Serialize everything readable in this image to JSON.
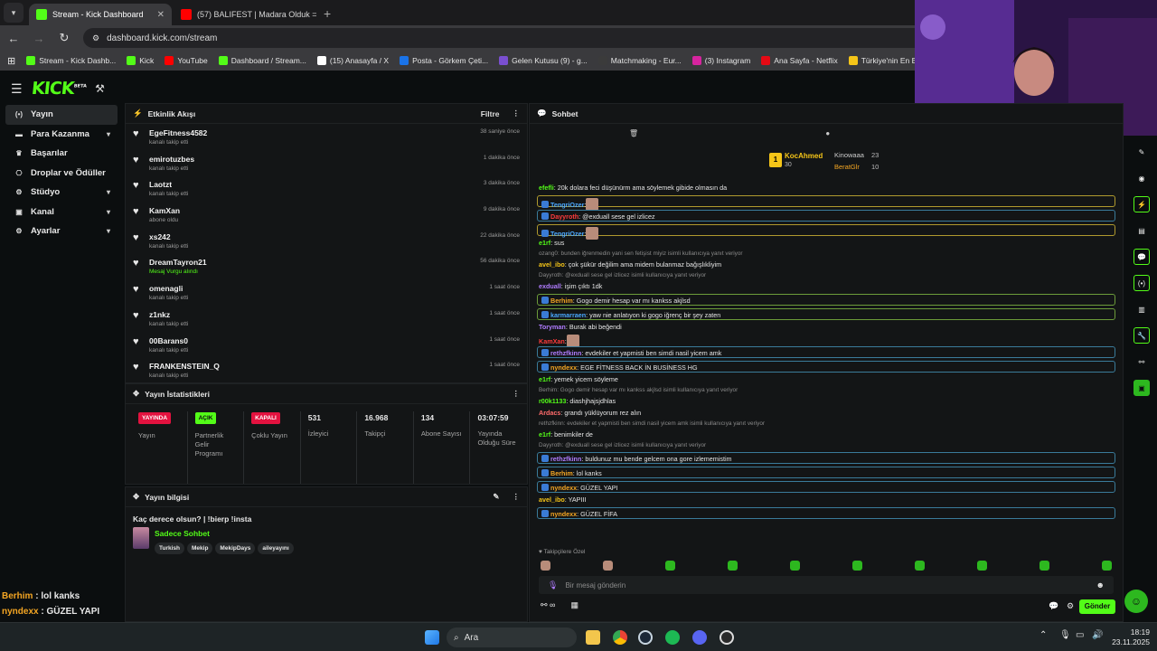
{
  "browser": {
    "tabs": [
      {
        "title": "Stream - Kick Dashboard",
        "color": "#53fc18"
      },
      {
        "title": "(57) BALIFEST | Madara Olduk =",
        "color": "#ff0000"
      }
    ],
    "url": "dashboard.kick.com/stream",
    "bookmarks": [
      {
        "label": "Stream - Kick Dashb...",
        "color": "#53fc18"
      },
      {
        "label": "Kick",
        "color": "#53fc18"
      },
      {
        "label": "YouTube",
        "color": "#ff0000"
      },
      {
        "label": "Dashboard / Stream...",
        "color": "#53fc18"
      },
      {
        "label": "(15) Anasayfa / X",
        "color": "#ffffff"
      },
      {
        "label": "Posta - Görkem Çeti...",
        "color": "#1a73e8"
      },
      {
        "label": "Gelen Kutusu (9) - g...",
        "color": "#7a4fd0"
      },
      {
        "label": "Matchmaking - Eur...",
        "color": "#3b3b3b"
      },
      {
        "label": "(3) Instagram",
        "color": "#d6249f"
      },
      {
        "label": "Ana Sayfa - Netflix",
        "color": "#e50914"
      },
      {
        "label": "Türkiye'nin En Büyü...",
        "color": "#f5c518"
      }
    ]
  },
  "kick": {
    "logo": "KICK",
    "logo_sup": "BETA"
  },
  "sidebar": {
    "items": [
      {
        "label": "Yayın",
        "icon": "broadcast-icon",
        "glyph": "(•)",
        "chev": ""
      },
      {
        "label": "Para Kazanma",
        "icon": "money-icon",
        "glyph": "▬",
        "chev": "▾"
      },
      {
        "label": "Başarılar",
        "icon": "trophy-icon",
        "glyph": "♛",
        "chev": ""
      },
      {
        "label": "Droplar ve Ödüller",
        "icon": "gift-icon",
        "glyph": "⎔",
        "chev": ""
      },
      {
        "label": "Stüdyo",
        "icon": "studio-icon",
        "glyph": "⚙",
        "chev": "▾"
      },
      {
        "label": "Kanal",
        "icon": "channel-icon",
        "glyph": "▣",
        "chev": "▾"
      },
      {
        "label": "Ayarlar",
        "icon": "settings-icon",
        "glyph": "⚙",
        "chev": "▾"
      }
    ]
  },
  "activity": {
    "title": "Etkinlik Akışı",
    "filter": "Filtre",
    "items": [
      {
        "name": "EgeFitness4582",
        "desc": "kanalı takip etti",
        "time": "38 saniye önce"
      },
      {
        "name": "emirotuzbes",
        "desc": "kanalı takip etti",
        "time": "1 dakika önce"
      },
      {
        "name": "Laotzt",
        "desc": "kanalı takip etti",
        "time": "3 dakika önce"
      },
      {
        "name": "KamXan",
        "desc": "abone oldu",
        "time": "9 dakika önce"
      },
      {
        "name": "xs242",
        "desc": "kanalı takip etti",
        "time": "22 dakika önce"
      },
      {
        "name": "DreamTayron21",
        "desc": "Mesaj Vurgu alındı",
        "time": "56 dakika önce"
      },
      {
        "name": "omenagli",
        "desc": "kanalı takip etti",
        "time": "1 saat önce"
      },
      {
        "name": "z1nkz",
        "desc": "kanalı takip etti",
        "time": "1 saat önce"
      },
      {
        "name": "00Barans0",
        "desc": "kanalı takip etti",
        "time": "1 saat önce"
      },
      {
        "name": "FRANKENSTEIN_Q",
        "desc": "kanalı takip etti",
        "time": "1 saat önce"
      }
    ]
  },
  "stats": {
    "title": "Yayın İstatistikleri",
    "items": [
      {
        "badge": "YAYINDA",
        "badge_bg": "#e3123f",
        "badge_fg": "#ffffff",
        "label": "Yayın"
      },
      {
        "badge": "AÇIK",
        "badge_bg": "#53fc18",
        "badge_fg": "#0b0e0f",
        "label": "Partnerlik Gelir Programı"
      },
      {
        "badge": "KAPALI",
        "badge_bg": "#e3123f",
        "badge_fg": "#ffffff",
        "label": "Çoklu Yayın"
      },
      {
        "value": "531",
        "label": "İzleyici"
      },
      {
        "value": "16.968",
        "label": "Takipçi"
      },
      {
        "value": "134",
        "label": "Abone Sayısı"
      },
      {
        "value": "03:07:59",
        "label": "Yayında Olduğu Süre"
      }
    ]
  },
  "info": {
    "title": "Yayın bilgisi",
    "stream_title": "Kaç derece olsun? | !bierp !insta",
    "category": "Sadece Sohbet",
    "tags": [
      "Turkish",
      "Mekip",
      "MekipDays",
      "aileyayını"
    ]
  },
  "chat": {
    "title": "Sohbet",
    "top": [
      {
        "name": "KocAhmed",
        "value": "30"
      },
      {
        "name": "Kinowaaa",
        "value": "23"
      },
      {
        "name": "BeratGlr",
        "value": "10"
      }
    ],
    "messages": [
      {
        "user": "efefli",
        "color": "#53fc18",
        "text": ": 20k dolara feci düşünürm ama söylemek gibide olmasın da",
        "box": ""
      },
      {
        "user": "TengriOzer",
        "color": "#4aa8ff",
        "text": ":",
        "box": "y",
        "emote": true
      },
      {
        "user": "Dayyroth",
        "color": "#ff3b3b",
        "text": ": @exduall sese gel izlicez",
        "box": "b"
      },
      {
        "user": "TengriOzer",
        "color": "#4aa8ff",
        "text": ":",
        "box": "y",
        "emote": true
      },
      {
        "user": "e1rf",
        "color": "#53fc18",
        "text": ": sus",
        "box": ""
      },
      {
        "user": "",
        "color": "#888",
        "text": "ozang0: bunden iğrenmedin yani sen fetişist miyiz isimli kullanıcıya yanıt veriyor",
        "box": "",
        "reply": true
      },
      {
        "user": "avel_ibo",
        "color": "#f5c518",
        "text": ": çok şükür değilim ama midem bulanmaz bağışlıkliyim",
        "box": ""
      },
      {
        "user": "",
        "color": "#888",
        "text": "Dayyroth: @exduall sese gel izlicez isimli kullanıcıya yanıt veriyor",
        "box": "",
        "reply": true
      },
      {
        "user": "exduall",
        "color": "#b07cff",
        "text": ": işim çıktı 1dk",
        "box": ""
      },
      {
        "user": "Berhim",
        "color": "#f5a623",
        "text": ": Gogo demir hesap var mı kankss akjlsd",
        "box": "g"
      },
      {
        "user": "karmarraen",
        "color": "#4aa8ff",
        "text": ": yaw nie anlatıyon ki gogo iğrenç bir şey zaten",
        "box": "g"
      },
      {
        "user": "Toryman",
        "color": "#b07cff",
        "text": ": Burak abi beğendi",
        "box": ""
      },
      {
        "user": "KamXan",
        "color": "#ff3b3b",
        "text": ":",
        "box": "",
        "emote": true
      },
      {
        "user": "rethzfkinn",
        "color": "#b07cff",
        "text": ": evdekiler et yapmisti ben simdi nasil yicem amk",
        "box": "b"
      },
      {
        "user": "nyndexx",
        "color": "#f5a623",
        "text": ": EGE FİTNESS BACK İN BUSİNESS HG",
        "box": "b"
      },
      {
        "user": "e1rf",
        "color": "#53fc18",
        "text": ": yemek yicem söyleme",
        "box": ""
      },
      {
        "user": "",
        "color": "#888",
        "text": "Berhim: Gogo demir hesap var mı kankss akjlsd isimli kullanıcıya yanıt veriyor",
        "box": "",
        "reply": true
      },
      {
        "user": "r00k1133",
        "color": "#53fc18",
        "text": ": diashjhajsjdhlas",
        "box": ""
      },
      {
        "user": "Ardacs",
        "color": "#ff6b6b",
        "text": ": grandı yüklüyorum rez alın",
        "box": ""
      },
      {
        "user": "",
        "color": "#888",
        "text": "rethzfkinn: evdekiler et yapmisti ben simdi nasil yicem amk isimli kullanıcıya yanıt veriyor",
        "box": "",
        "reply": true
      },
      {
        "user": "e1rf",
        "color": "#53fc18",
        "text": ": benimkiler de",
        "box": ""
      },
      {
        "user": "",
        "color": "#888",
        "text": "Dayyroth: @exduall sese gel izlicez isimli kullanıcıya yanıt veriyor",
        "box": "",
        "reply": true
      },
      {
        "user": "rethzfkinn",
        "color": "#b07cff",
        "text": ": buldunuz mu bende gelcem ona gore izlememistim",
        "box": "b"
      },
      {
        "user": "Berhim",
        "color": "#f5a623",
        "text": ": lol kanks",
        "box": "b"
      },
      {
        "user": "nyndexx",
        "color": "#f5a623",
        "text": ": GÜZEL YAPI",
        "box": "b"
      },
      {
        "user": "avel_ibo",
        "color": "#f5c518",
        "text": ": YAPIII",
        "box": ""
      },
      {
        "user": "nyndexx",
        "color": "#f5a623",
        "text": ": GÜZEL FİFA",
        "box": "b"
      }
    ],
    "followers_only": "Takipçilere Özel",
    "placeholder": "Bir mesaj gönderin",
    "send": "Gönder"
  },
  "overlay": [
    {
      "user": "Berhim",
      "color": "#f5a623",
      "text": " : lol kanks"
    },
    {
      "user": "nyndexx",
      "color": "#f5a623",
      "text": " : GÜZEL YAPI"
    },
    {
      "user": "avel_ibo",
      "color": "#f5c518",
      "text": " : YAPIII"
    },
    {
      "user": "nyndexx",
      "color": "#f5a623",
      "text": " : GÜZEL FİFA"
    }
  ],
  "taskbar": {
    "search": "Ara",
    "time": "18:19",
    "date": "23.11.2025"
  }
}
